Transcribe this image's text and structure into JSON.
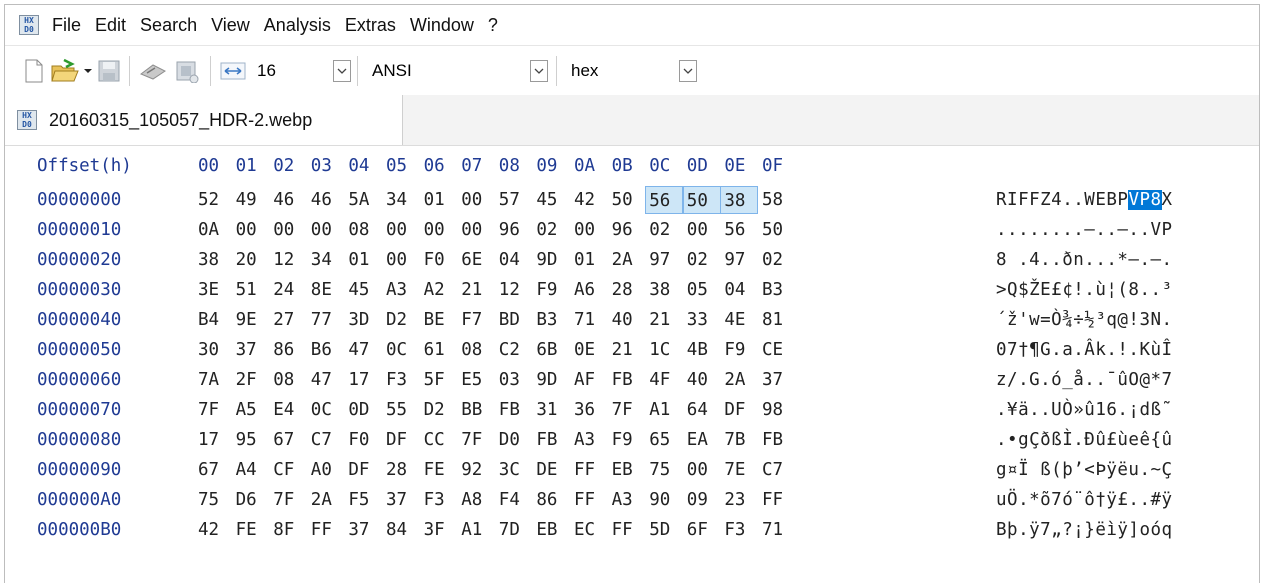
{
  "menu": [
    "File",
    "Edit",
    "Search",
    "View",
    "Analysis",
    "Extras",
    "Window",
    "?"
  ],
  "app_icon": {
    "name": "hxd-icon",
    "text": "HX\nD0"
  },
  "toolbar": {
    "bytes_per_row": "16",
    "charset": "ANSI",
    "display": "hex"
  },
  "tab": {
    "label": "20160315_105057_HDR-2.webp"
  },
  "hex": {
    "header_label": "Offset(h)",
    "columns": [
      "00",
      "01",
      "02",
      "03",
      "04",
      "05",
      "06",
      "07",
      "08",
      "09",
      "0A",
      "0B",
      "0C",
      "0D",
      "0E",
      "0F"
    ],
    "rows": [
      {
        "offset": "00000000",
        "bytes": [
          "52",
          "49",
          "46",
          "46",
          "5A",
          "34",
          "01",
          "00",
          "57",
          "45",
          "42",
          "50",
          "56",
          "50",
          "38",
          "58"
        ],
        "ascii_pre": "RIFFZ4..WEBP",
        "ascii_hl": "VP8",
        "ascii_post": "X"
      },
      {
        "offset": "00000010",
        "bytes": [
          "0A",
          "00",
          "00",
          "00",
          "08",
          "00",
          "00",
          "00",
          "96",
          "02",
          "00",
          "96",
          "02",
          "00",
          "56",
          "50"
        ],
        "ascii_pre": "........–..–..VP",
        "ascii_hl": "",
        "ascii_post": ""
      },
      {
        "offset": "00000020",
        "bytes": [
          "38",
          "20",
          "12",
          "34",
          "01",
          "00",
          "F0",
          "6E",
          "04",
          "9D",
          "01",
          "2A",
          "97",
          "02",
          "97",
          "02"
        ],
        "ascii_pre": "8 .4..ðn...*—.—.",
        "ascii_hl": "",
        "ascii_post": ""
      },
      {
        "offset": "00000030",
        "bytes": [
          "3E",
          "51",
          "24",
          "8E",
          "45",
          "A3",
          "A2",
          "21",
          "12",
          "F9",
          "A6",
          "28",
          "38",
          "05",
          "04",
          "B3"
        ],
        "ascii_pre": ">Q$ŽE£¢!.ù¦(8..³",
        "ascii_hl": "",
        "ascii_post": ""
      },
      {
        "offset": "00000040",
        "bytes": [
          "B4",
          "9E",
          "27",
          "77",
          "3D",
          "D2",
          "BE",
          "F7",
          "BD",
          "B3",
          "71",
          "40",
          "21",
          "33",
          "4E",
          "81"
        ],
        "ascii_pre": "´ž'w=Ò¾÷½³q@!3N.",
        "ascii_hl": "",
        "ascii_post": ""
      },
      {
        "offset": "00000050",
        "bytes": [
          "30",
          "37",
          "86",
          "B6",
          "47",
          "0C",
          "61",
          "08",
          "C2",
          "6B",
          "0E",
          "21",
          "1C",
          "4B",
          "F9",
          "CE"
        ],
        "ascii_pre": "07†¶G.a.Âk.!.KùÎ",
        "ascii_hl": "",
        "ascii_post": ""
      },
      {
        "offset": "00000060",
        "bytes": [
          "7A",
          "2F",
          "08",
          "47",
          "17",
          "F3",
          "5F",
          "E5",
          "03",
          "9D",
          "AF",
          "FB",
          "4F",
          "40",
          "2A",
          "37"
        ],
        "ascii_pre": "z/.G.ó_å..¯ûO@*7",
        "ascii_hl": "",
        "ascii_post": ""
      },
      {
        "offset": "00000070",
        "bytes": [
          "7F",
          "A5",
          "E4",
          "0C",
          "0D",
          "55",
          "D2",
          "BB",
          "FB",
          "31",
          "36",
          "7F",
          "A1",
          "64",
          "DF",
          "98"
        ],
        "ascii_pre": ".¥ä..UÒ»û16.¡dß˜",
        "ascii_hl": "",
        "ascii_post": ""
      },
      {
        "offset": "00000080",
        "bytes": [
          "17",
          "95",
          "67",
          "C7",
          "F0",
          "DF",
          "CC",
          "7F",
          "D0",
          "FB",
          "A3",
          "F9",
          "65",
          "EA",
          "7B",
          "FB"
        ],
        "ascii_pre": ".•gÇðßÌ.Ðû£ùeê{û",
        "ascii_hl": "",
        "ascii_post": ""
      },
      {
        "offset": "00000090",
        "bytes": [
          "67",
          "A4",
          "CF",
          "A0",
          "DF",
          "28",
          "FE",
          "92",
          "3C",
          "DE",
          "FF",
          "EB",
          "75",
          "00",
          "7E",
          "C7"
        ],
        "ascii_pre": "g¤Ï ß(þ’<Þÿëu.~Ç",
        "ascii_hl": "",
        "ascii_post": ""
      },
      {
        "offset": "000000A0",
        "bytes": [
          "75",
          "D6",
          "7F",
          "2A",
          "F5",
          "37",
          "F3",
          "A8",
          "F4",
          "86",
          "FF",
          "A3",
          "90",
          "09",
          "23",
          "FF"
        ],
        "ascii_pre": "uÖ.*õ7ó¨ô†ÿ£..#ÿ",
        "ascii_hl": "",
        "ascii_post": ""
      },
      {
        "offset": "000000B0",
        "bytes": [
          "42",
          "FE",
          "8F",
          "FF",
          "37",
          "84",
          "3F",
          "A1",
          "7D",
          "EB",
          "EC",
          "FF",
          "5D",
          "6F",
          "F3",
          "71"
        ],
        "ascii_pre": "Bþ.ÿ7„?¡}ëìÿ]oóq",
        "ascii_hl": "",
        "ascii_post": ""
      }
    ],
    "selected_cols": [
      12,
      13,
      14
    ]
  }
}
